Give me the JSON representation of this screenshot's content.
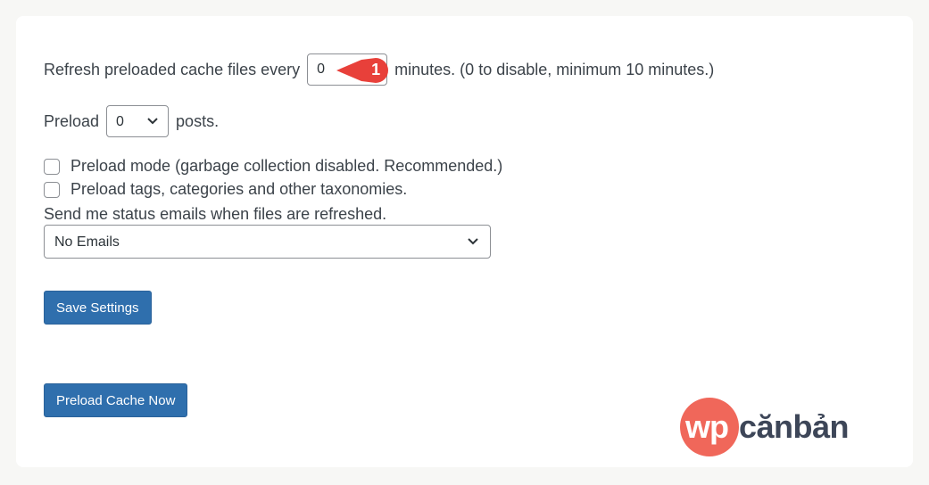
{
  "refresh_row": {
    "prefix": "Refresh preloaded cache files every",
    "value": "0",
    "suffix": "minutes. (0 to disable, minimum 10 minutes.)",
    "callout_number": "1",
    "callout_color": "#e8403a"
  },
  "preload_row": {
    "prefix": "Preload",
    "selected": "0",
    "suffix": "posts."
  },
  "options": {
    "preload_mode_label": "Preload mode (garbage collection disabled. Recommended.)",
    "preload_mode_checked": false,
    "preload_taxonomies_label": "Preload tags, categories and other taxonomies.",
    "preload_taxonomies_checked": false
  },
  "email": {
    "label": "Send me status emails when files are refreshed.",
    "selected": "No Emails"
  },
  "buttons": {
    "save_label": "Save Settings",
    "preload_now_label": "Preload Cache Now",
    "button_color": "#2f6fad"
  },
  "logo": {
    "part1": "wp",
    "part2": "cănbản",
    "circle_color": "#f0675a",
    "text_color": "#3d4658"
  },
  "icons": {
    "select_arrow": "chevron-down-icon",
    "callout": "callout-arrow-icon"
  }
}
